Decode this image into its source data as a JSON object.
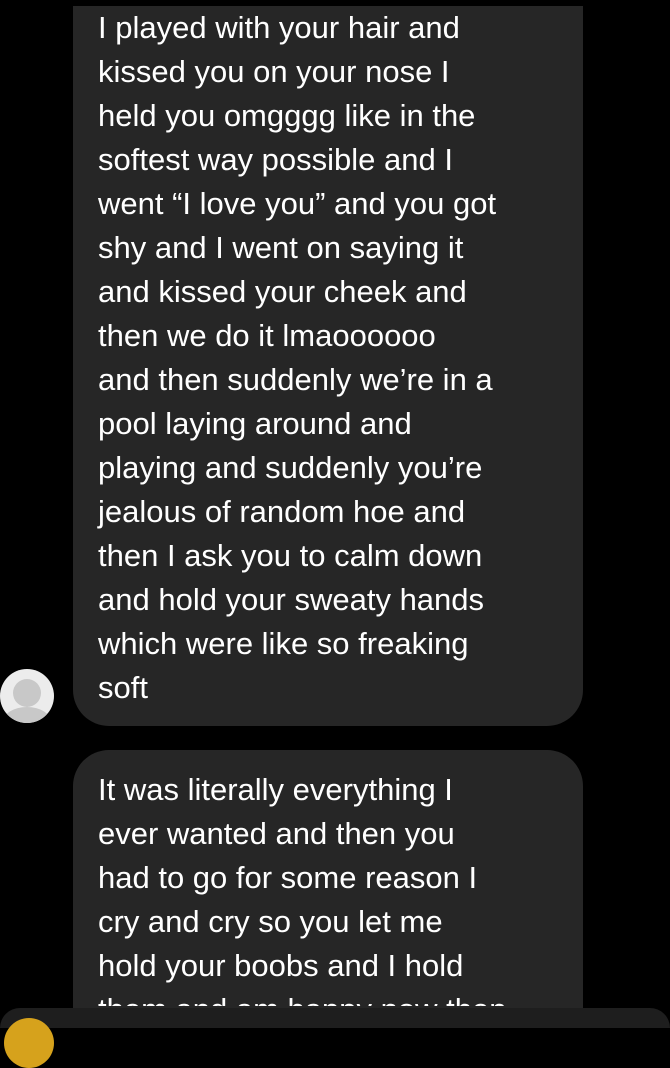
{
  "colors": {
    "background": "#000000",
    "bubble": "#262626",
    "text": "#ffffff",
    "avatar": "#ececec",
    "bottom_avatar": "#d6a21c"
  },
  "messages": [
    {
      "lines": [
        "I played with your hair and",
        "kissed you on your nose I",
        "held you omgggg like in the",
        "softest way possible and I",
        "went “I love you” and you got",
        "shy and I went on saying it",
        "and kissed your cheek and",
        "then we do it lmaoooooo",
        "and then suddenly we’re in a",
        "pool laying around and",
        "playing and suddenly you’re",
        "jealous of random hoe and",
        "then I ask you to calm down",
        "and hold your sweaty hands",
        "which were like so freaking",
        "soft"
      ]
    },
    {
      "lines": [
        "It was literally everything I",
        "ever wanted and then you",
        "had to go for some reason I",
        "cry and cry so you let me",
        "hold your boobs and I hold",
        "them and am happy now then"
      ]
    }
  ],
  "sender_avatar_icon": "default-user-avatar-icon",
  "bottom_avatar_icon": "profile-avatar-icon"
}
